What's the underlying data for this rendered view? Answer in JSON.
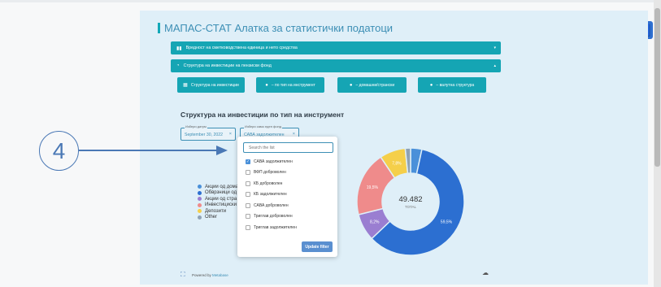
{
  "app": {
    "title": "МАПАС-СТАТ Алатка за статистички податоци"
  },
  "accordions": [
    {
      "label": "Вредност на сметководствена единица и нето средства",
      "icon": "bar-chart-icon",
      "caret": "▾"
    },
    {
      "label": "Структура на инвестиции на пензиски фонд",
      "icon": "pie-chart-icon",
      "caret": "▴"
    }
  ],
  "subtabs": [
    {
      "label": "Структура на инвестиции",
      "icon": "calendar-icon"
    },
    {
      "label": "– по тип на инструмент",
      "icon": "chart-icon"
    },
    {
      "label": "– домашни/странски",
      "icon": "chart-icon"
    },
    {
      "label": "– валутна структура",
      "icon": "chart-icon"
    }
  ],
  "section": {
    "title": "Структура на инвестиции по тип на инструмент"
  },
  "filters": {
    "date": {
      "label": "Избери датум",
      "value": "September 30, 2022",
      "clear": "×"
    },
    "fund": {
      "label": "Избери само еден фонд",
      "value": "САВА задолжителен",
      "clear": "×"
    }
  },
  "dropdown": {
    "search_placeholder": "Search the list",
    "options": [
      {
        "label": "САВА задолжителен",
        "checked": true
      },
      {
        "label": "ВФП доброволен",
        "checked": false
      },
      {
        "label": "КБ доброволен",
        "checked": false
      },
      {
        "label": "КБ задолжителен",
        "checked": false
      },
      {
        "label": "САВА доброволен",
        "checked": false
      },
      {
        "label": "Триглав доброволен",
        "checked": false
      },
      {
        "label": "Триглав задолжителен",
        "checked": false
      }
    ],
    "update_label": "Update filter"
  },
  "annotation": {
    "number": "4"
  },
  "chart_data": {
    "type": "pie",
    "title": "Структура на инвестиции по тип на инструмент",
    "total_value": "49.482",
    "total_label": "TOTAL",
    "series": [
      {
        "name": "Акции од дома",
        "color": "#4a90d9"
      },
      {
        "name": "Обврзници од",
        "color": "#2c6fd1"
      },
      {
        "name": "Акции од стра",
        "color": "#9a7ed1"
      },
      {
        "name": "Инвестициски",
        "color": "#ef8b8b"
      },
      {
        "name": "Депозити",
        "color": "#f5cf4a"
      },
      {
        "name": "Other",
        "color": "#8fa2b5"
      }
    ],
    "slices": [
      {
        "name": "Акции од дома",
        "value": 3.4,
        "label": "",
        "color": "#4a90d9"
      },
      {
        "name": "Обврзници од",
        "value": 59.5,
        "label": "59,5%",
        "color": "#2c6fd1"
      },
      {
        "name": "Акции од стра",
        "value": 8.2,
        "label": "8,2%",
        "color": "#9a7ed1"
      },
      {
        "name": "Инвестициски",
        "value": 19.5,
        "label": "19,5%",
        "color": "#ef8b8b"
      },
      {
        "name": "Депозити",
        "value": 7.8,
        "label": "7,8%",
        "color": "#f5cf4a"
      },
      {
        "name": "Other",
        "value": 1.6,
        "label": "",
        "color": "#8fa2b5"
      }
    ]
  },
  "footer": {
    "powered_by": "Powered by",
    "brand": "Metabase"
  }
}
